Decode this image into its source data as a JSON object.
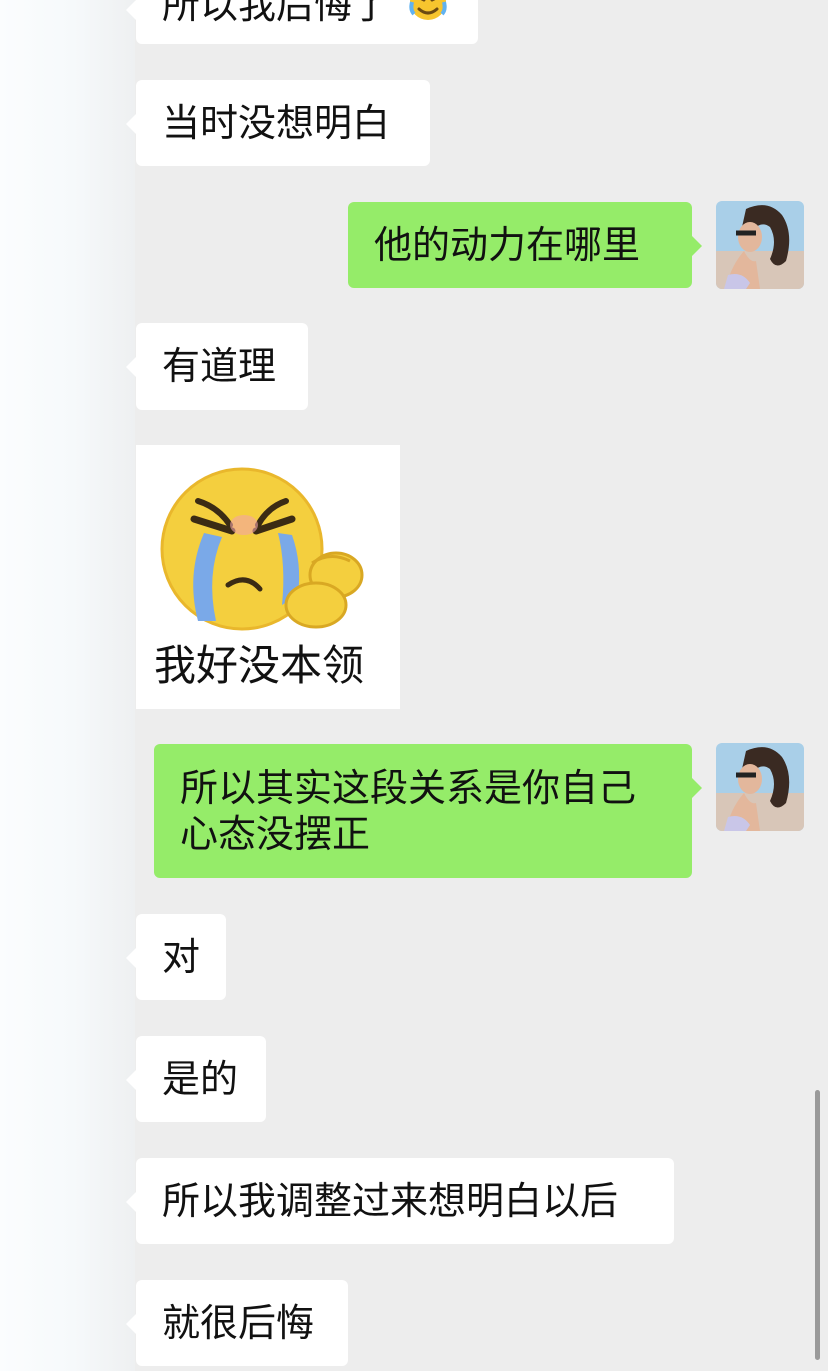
{
  "colors": {
    "background": "#ededed",
    "incoming_bubble": "#ffffff",
    "outgoing_bubble": "#95ec69",
    "text": "#111111"
  },
  "messages": [
    {
      "side": "incoming",
      "text": "所以我后悔了",
      "emoji": "tears-of-joy-emoji"
    },
    {
      "side": "incoming",
      "text": "当时没想明白"
    },
    {
      "side": "outgoing",
      "text": "他的动力在哪里",
      "avatar": "user-avatar"
    },
    {
      "side": "incoming",
      "text": "有道理"
    },
    {
      "side": "incoming",
      "type": "sticker",
      "sticker_icon": "crying-face-sticker",
      "caption": "我好没本领"
    },
    {
      "side": "outgoing",
      "text": "所以其实这段关系是你自己心态没摆正",
      "avatar": "user-avatar"
    },
    {
      "side": "incoming",
      "text": "对"
    },
    {
      "side": "incoming",
      "text": "是的"
    },
    {
      "side": "incoming",
      "text": "所以我调整过来想明白以后"
    },
    {
      "side": "incoming",
      "text": "就很后悔"
    }
  ]
}
